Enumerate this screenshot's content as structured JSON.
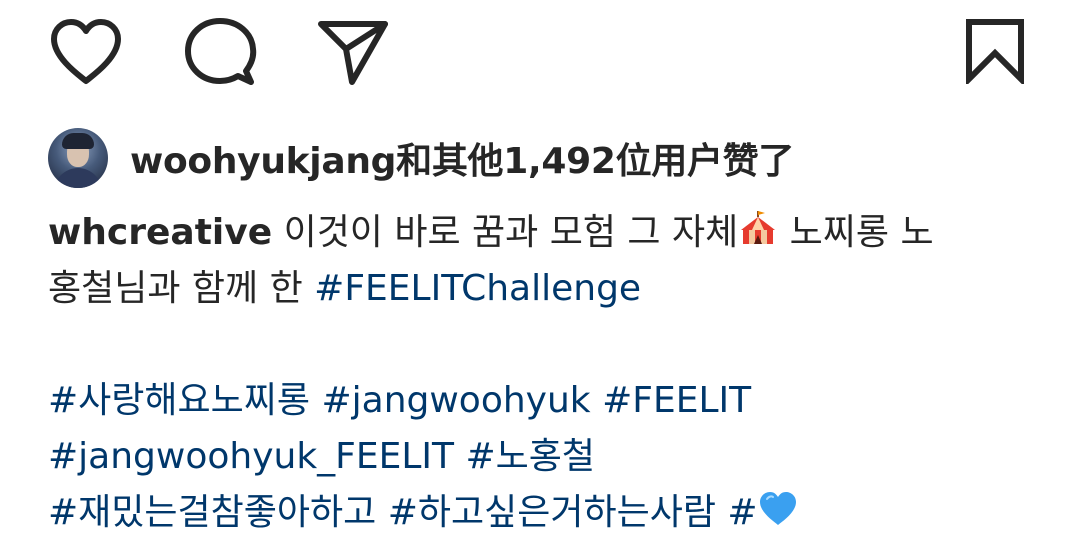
{
  "actions": {
    "like_icon": "heart-outline",
    "comment_icon": "speech-bubble-outline",
    "share_icon": "paper-plane-outline",
    "save_icon": "bookmark-outline"
  },
  "likes": {
    "username": "woohyukjang",
    "suffix": "和其他1,492位用户赞了"
  },
  "caption": {
    "author": "whcreative",
    "line1_text": " 이것이 바로 꿈과 모험 그 자체",
    "line1_emoji": "circus-tent",
    "line1_tail": " 노찌롱 노",
    "line2_text": "홍철님과 함께 한 ",
    "line2_tag": "#FEELITChallenge",
    "tag_sarang": "#사랑해요노찌롱",
    "tag_jangwoohyuk": "#jangwoohyuk",
    "tag_feelit": "#FEELIT",
    "tag_jangwoohyuk_feelit": "#jangwoohyuk_FEELIT",
    "tag_nohongchul": "#노홍철",
    "tag_jaemit": "#재밌는걸참좋아하고",
    "tag_hagosipeun": "#하고싶은거하는사람",
    "tag_heart_prefix": "#",
    "tag_heart_emoji": "blue-heart"
  },
  "colors": {
    "text": "#262626",
    "hashtag": "#00376b",
    "heart_blue": "#3aa0f0"
  }
}
